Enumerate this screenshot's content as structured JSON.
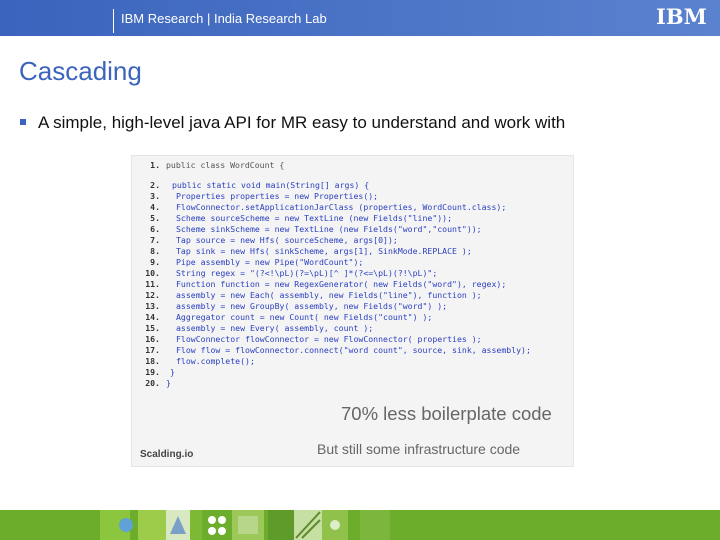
{
  "header": {
    "org_text": "IBM Research  |  India Research Lab",
    "logo_text": "IBM"
  },
  "slide": {
    "title": "Cascading",
    "bullet": "A simple, high-level java API for MR easy to understand and work with"
  },
  "code_image": {
    "lines": [
      {
        "n": "1.",
        "kw": "",
        "text": "public class WordCount {"
      },
      {
        "n": "2.",
        "kw": "",
        "text": "public static void main(String[] args) {"
      },
      {
        "n": "3.",
        "kw": "",
        "text": "Properties properties = new Properties();"
      },
      {
        "n": "4.",
        "kw": "",
        "text": "FlowConnector.setApplicationJarClass (properties, WordCount.class);"
      },
      {
        "n": "5.",
        "kw": "",
        "text": "Scheme sourceScheme = new TextLine (new Fields(\"line\"));"
      },
      {
        "n": "6.",
        "kw": "",
        "text": "Scheme sinkScheme = new TextLine (new Fields(\"word\",\"count\"));"
      },
      {
        "n": "7.",
        "kw": "",
        "text": "Tap source = new Hfs( sourceScheme, args[0]);"
      },
      {
        "n": "8.",
        "kw": "",
        "text": "Tap sink = new Hfs( sinkScheme, args[1], SinkMode.REPLACE );"
      },
      {
        "n": "9.",
        "kw": "",
        "text": "Pipe assembly = new Pipe(\"WordCount\");"
      },
      {
        "n": "10.",
        "kw": "",
        "text": "String regex = \"(?<!\\pL)(?=\\pL)[^ ]*(?<=\\pL)(?!\\pL)\";"
      },
      {
        "n": "11.",
        "kw": "",
        "text": "Function function = new RegexGenerator( new Fields(\"word\"), regex);"
      },
      {
        "n": "12.",
        "kw": "",
        "text": "assembly = new Each( assembly, new Fields(\"line\"), function );"
      },
      {
        "n": "13.",
        "kw": "",
        "text": "assembly = new GroupBy( assembly, new Fields(\"word\") );"
      },
      {
        "n": "14.",
        "kw": "",
        "text": "Aggregator count = new Count( new Fields(\"count\") );"
      },
      {
        "n": "15.",
        "kw": "",
        "text": "assembly = new Every( assembly, count );"
      },
      {
        "n": "16.",
        "kw": "",
        "text": "FlowConnector flowConnector = new FlowConnector( properties );"
      },
      {
        "n": "17.",
        "kw": "",
        "text": "Flow flow = flowConnector.connect(\"word count\", source, sink, assembly);"
      },
      {
        "n": "18.",
        "kw": "",
        "text": "flow.complete();"
      },
      {
        "n": "19.",
        "kw": "",
        "text": "}"
      },
      {
        "n": "20.",
        "kw": "",
        "text": "}"
      }
    ],
    "boilerplate_text": "70% less boilerplate code",
    "infra_text": "But still some infrastructure code",
    "source_text": "Scalding.io"
  },
  "colors": {
    "header": "#4d72c2",
    "title": "#3a64bd",
    "footer": "#6cae2c"
  }
}
